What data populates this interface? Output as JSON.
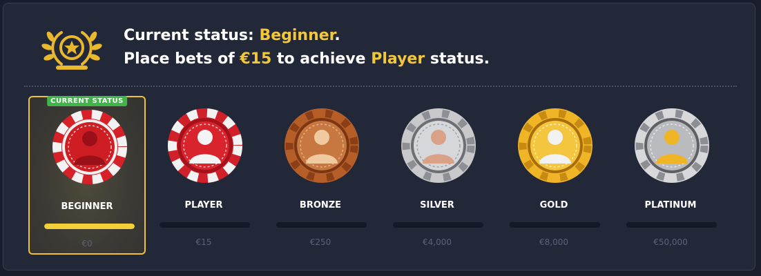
{
  "header": {
    "icon": "laurel-star-icon",
    "line1_prefix": "Current status: ",
    "line1_status": "Beginner",
    "line1_suffix": ".",
    "line2_prefix": "Place bets of ",
    "line2_amount": "€15",
    "line2_middle": " to achieve ",
    "line2_status": "Player",
    "line2_suffix": " status."
  },
  "current_badge": "CURRENT STATUS",
  "colors": {
    "accent": "#f3c73a",
    "badge": "#41b54a",
    "progress": "#f3cf3a"
  },
  "levels": [
    {
      "name": "BEGINNER",
      "amount": "€0",
      "progress": 1.0,
      "current": true,
      "chip": "beginner-chip-icon"
    },
    {
      "name": "PLAYER",
      "amount": "€15",
      "progress": 0,
      "current": false,
      "chip": "player-chip-icon"
    },
    {
      "name": "BRONZE",
      "amount": "€250",
      "progress": 0,
      "current": false,
      "chip": "bronze-chip-icon"
    },
    {
      "name": "SILVER",
      "amount": "€4,000",
      "progress": 0,
      "current": false,
      "chip": "silver-chip-icon"
    },
    {
      "name": "GOLD",
      "amount": "€8,000",
      "progress": 0,
      "current": false,
      "chip": "gold-chip-icon"
    },
    {
      "name": "PLATINUM",
      "amount": "€50,000",
      "progress": 0,
      "current": false,
      "chip": "platinum-chip-icon"
    }
  ]
}
